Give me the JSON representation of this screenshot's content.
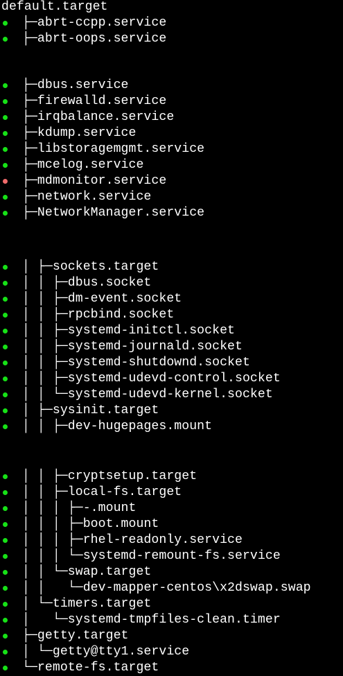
{
  "colors": {
    "background": "#000000",
    "text": "#ffffff",
    "status_active": "#17e117",
    "status_failed": "#f06b6b"
  },
  "header": "default.target",
  "lines": [
    {
      "text": "├─abrt-ccpp.service",
      "status": "active"
    },
    {
      "text": "├─abrt-oops.service",
      "status": "active"
    },
    {
      "text": "├─dbus.service",
      "status": "active"
    },
    {
      "text": "├─firewalld.service",
      "status": "active"
    },
    {
      "text": "├─irqbalance.service",
      "status": "active"
    },
    {
      "text": "├─kdump.service",
      "status": "active"
    },
    {
      "text": "├─libstoragemgmt.service",
      "status": "active"
    },
    {
      "text": "├─mcelog.service",
      "status": "active"
    },
    {
      "text": "├─mdmonitor.service",
      "status": "failed"
    },
    {
      "text": "├─network.service",
      "status": "active"
    },
    {
      "text": "├─NetworkManager.service",
      "status": "active"
    },
    {
      "text": "│ ├─sockets.target",
      "status": "active"
    },
    {
      "text": "│ │ ├─dbus.socket",
      "status": "active"
    },
    {
      "text": "│ │ ├─dm-event.socket",
      "status": "active"
    },
    {
      "text": "│ │ ├─rpcbind.socket",
      "status": "active"
    },
    {
      "text": "│ │ ├─systemd-initctl.socket",
      "status": "active"
    },
    {
      "text": "│ │ ├─systemd-journald.socket",
      "status": "active"
    },
    {
      "text": "│ │ ├─systemd-shutdownd.socket",
      "status": "active"
    },
    {
      "text": "│ │ ├─systemd-udevd-control.socket",
      "status": "active"
    },
    {
      "text": "│ │ └─systemd-udevd-kernel.socket",
      "status": "active"
    },
    {
      "text": "│ ├─sysinit.target",
      "status": "active"
    },
    {
      "text": "│ │ ├─dev-hugepages.mount",
      "status": "active"
    },
    {
      "text": "│ │ ├─cryptsetup.target",
      "status": "active"
    },
    {
      "text": "│ │ ├─local-fs.target",
      "status": "active"
    },
    {
      "text": "│ │ │ ├─-.mount",
      "status": "active"
    },
    {
      "text": "│ │ │ ├─boot.mount",
      "status": "active"
    },
    {
      "text": "│ │ │ ├─rhel-readonly.service",
      "status": "active"
    },
    {
      "text": "│ │ │ └─systemd-remount-fs.service",
      "status": "active"
    },
    {
      "text": "│ │ └─swap.target",
      "status": "active"
    },
    {
      "text": "│ │   └─dev-mapper-centos\\x2dswap.swap",
      "status": "active"
    },
    {
      "text": "│ └─timers.target",
      "status": "active"
    },
    {
      "text": "│   └─systemd-tmpfiles-clean.timer",
      "status": "active"
    },
    {
      "text": "├─getty.target",
      "status": "active"
    },
    {
      "text": "│ └─getty@tty1.service",
      "status": "active"
    },
    {
      "text": "└─remote-fs.target",
      "status": "active"
    }
  ]
}
